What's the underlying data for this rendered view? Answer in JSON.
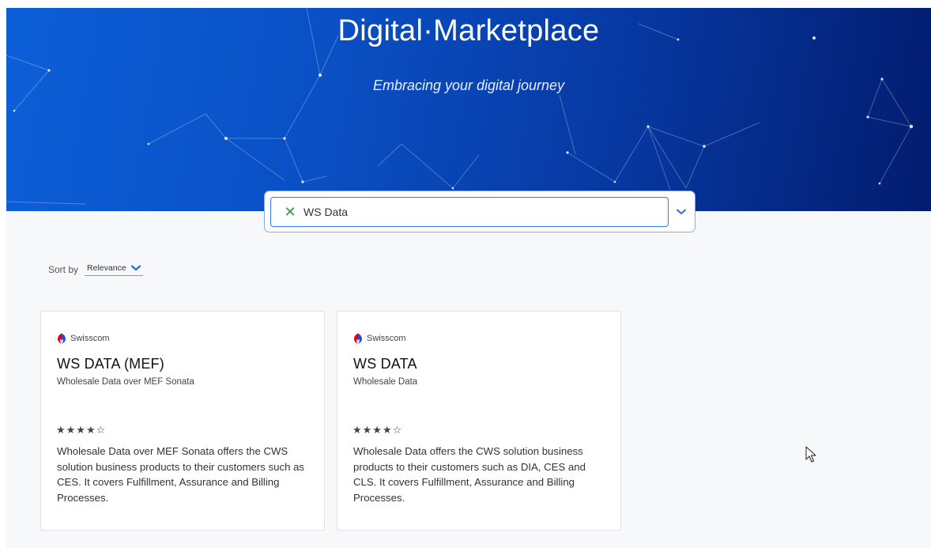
{
  "hero": {
    "title": "Digital·Marketplace",
    "subtitle": "Embracing your digital journey"
  },
  "search": {
    "value": "WS Data",
    "clear_icon": "close-icon",
    "dropdown_icon": "chevron-down-icon"
  },
  "sort": {
    "label": "Sort by",
    "selected": "Relevance"
  },
  "products": [
    {
      "vendor": "Swisscom",
      "title": "WS DATA (MEF)",
      "subtitle": "Wholesale Data over MEF Sonata",
      "rating": "★★★★☆",
      "rating_value": 4,
      "rating_max": 5,
      "description": "Wholesale Data over MEF Sonata offers the CWS solution business products to their customers such as CES. It covers Fulfillment, Assurance and Billing Processes."
    },
    {
      "vendor": "Swisscom",
      "title": "WS DATA",
      "subtitle": "Wholesale Data",
      "rating": "★★★★☆",
      "rating_value": 4,
      "rating_max": 5,
      "description": "Wholesale Data offers the CWS solution business products to their customers such as DIA, CES and CLS. It covers Fulfillment, Assurance and Billing Processes."
    }
  ],
  "colors": {
    "hero_start": "#0c5fd8",
    "hero_end": "#021c6e",
    "accent": "#2f7de1",
    "clear_icon": "#2e9a47"
  }
}
